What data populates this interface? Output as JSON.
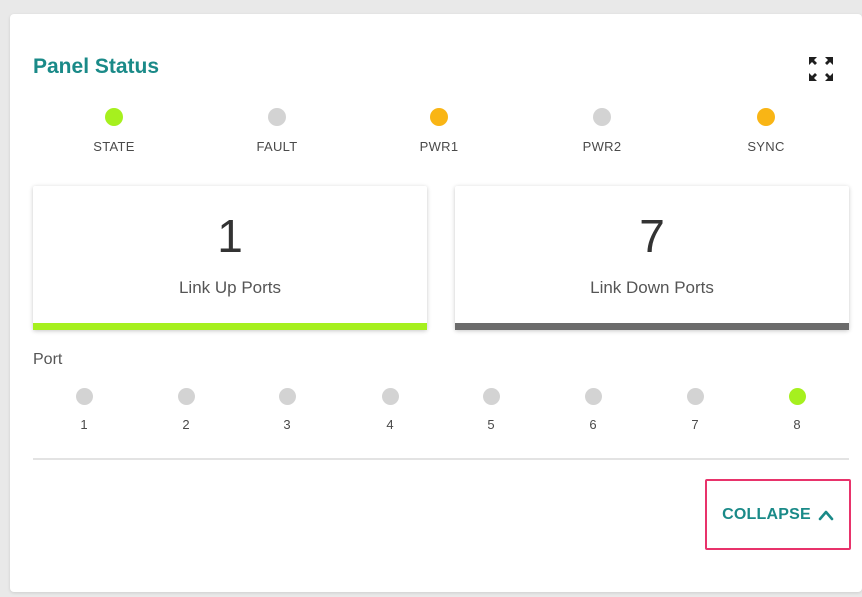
{
  "panel": {
    "title": "Panel Status"
  },
  "indicators": [
    {
      "label": "STATE",
      "color": "#a6f01e"
    },
    {
      "label": "FAULT",
      "color": "#d3d3d3"
    },
    {
      "label": "PWR1",
      "color": "#f9b515"
    },
    {
      "label": "PWR2",
      "color": "#d3d3d3"
    },
    {
      "label": "SYNC",
      "color": "#f9b515"
    }
  ],
  "stats": {
    "link_up": {
      "value": "1",
      "label": "Link Up Ports",
      "bar_color": "#a6f01e"
    },
    "link_down": {
      "value": "7",
      "label": "Link Down Ports",
      "bar_color": "#6b6b6b"
    }
  },
  "ports": {
    "title": "Port",
    "items": [
      {
        "label": "1",
        "color": "#d3d3d3"
      },
      {
        "label": "2",
        "color": "#d3d3d3"
      },
      {
        "label": "3",
        "color": "#d3d3d3"
      },
      {
        "label": "4",
        "color": "#d3d3d3"
      },
      {
        "label": "5",
        "color": "#d3d3d3"
      },
      {
        "label": "6",
        "color": "#d3d3d3"
      },
      {
        "label": "7",
        "color": "#d3d3d3"
      },
      {
        "label": "8",
        "color": "#a6f01e"
      }
    ]
  },
  "actions": {
    "collapse_label": "COLLAPSE",
    "collapse_icon": "chevron-up-icon",
    "expand_icon": "fullscreen-icon"
  },
  "colors": {
    "accent": "#1a8a88",
    "highlight_border": "#e8336b"
  }
}
